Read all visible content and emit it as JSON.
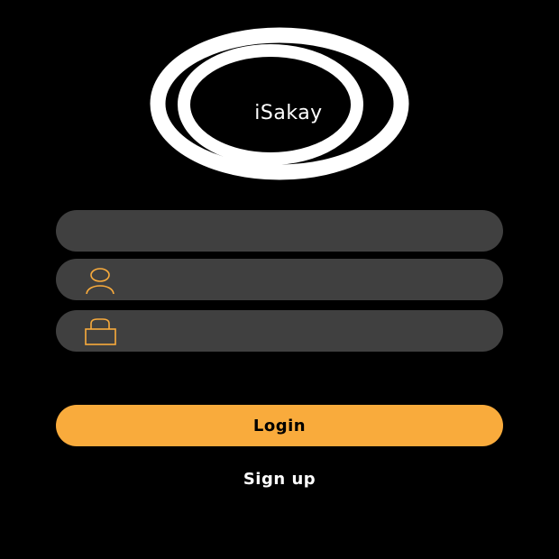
{
  "logo": {
    "text": "iSakay"
  },
  "fields": {
    "top": {
      "value": "",
      "placeholder": ""
    },
    "username": {
      "value": "",
      "placeholder": "",
      "icon": "user-icon"
    },
    "password": {
      "value": "",
      "placeholder": "",
      "icon": "lock-icon"
    }
  },
  "actions": {
    "login_label": "Login",
    "signup_label": "Sign up"
  },
  "colors": {
    "background": "#000000",
    "field_background": "#404040",
    "accent": "#f9ab3c",
    "text": "#ffffff"
  }
}
